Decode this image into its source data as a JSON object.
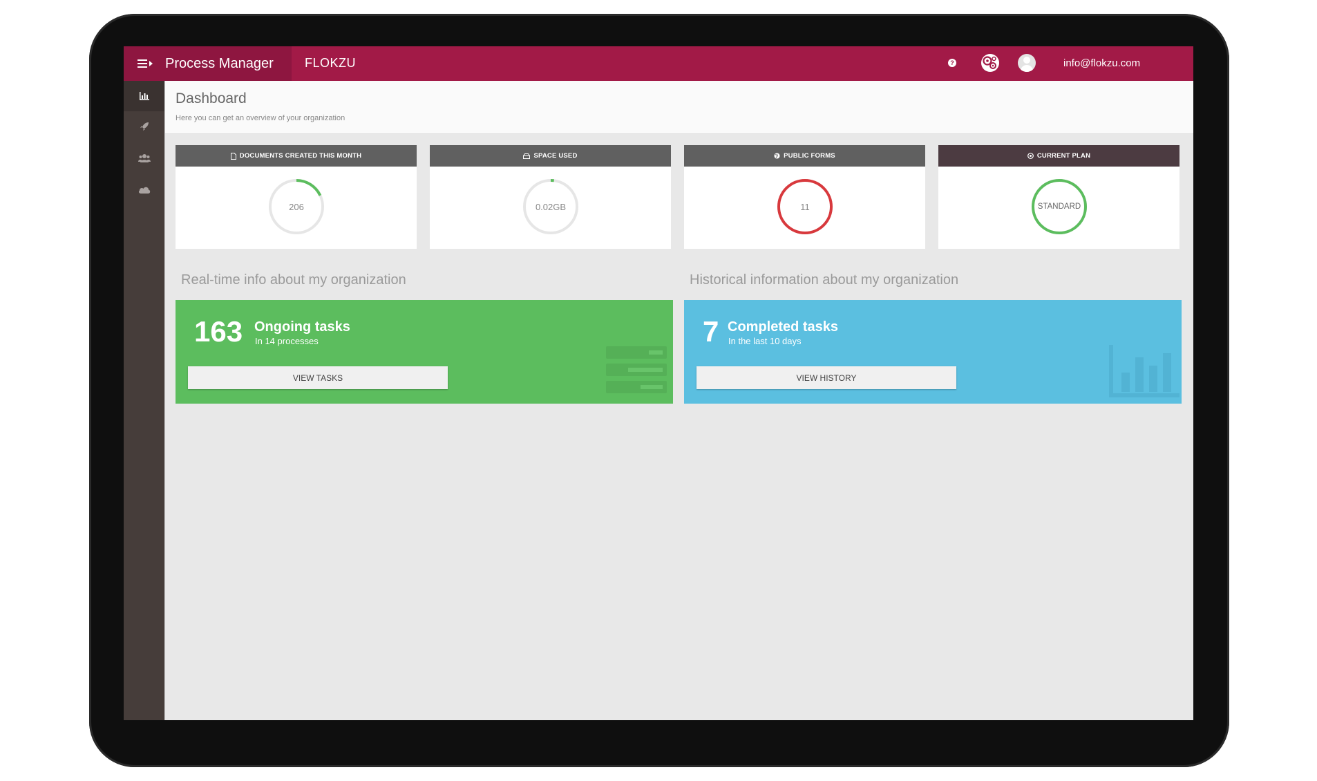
{
  "topbar": {
    "app_title": "Process Manager",
    "org_name": "FLOKZU",
    "help_glyph": "?",
    "user_email": "info@flokzu.com"
  },
  "sidebar": {
    "items": [
      {
        "icon": "bar-chart-icon",
        "active": true
      },
      {
        "icon": "rocket-icon",
        "active": false
      },
      {
        "icon": "users-icon",
        "active": false
      },
      {
        "icon": "cloud-icon",
        "active": false
      }
    ]
  },
  "header": {
    "title": "Dashboard",
    "subtitle": "Here you can get an overview of your organization"
  },
  "stats": [
    {
      "label": "DOCUMENTS CREATED THIS MONTH",
      "value": "206",
      "ring_color": "#5cbd5e",
      "progress": 0.18
    },
    {
      "label": "SPACE USED",
      "value": "0.02GB",
      "ring_color": "#5cbd5e",
      "progress": 0.02
    },
    {
      "label": "PUBLIC FORMS",
      "value": "11",
      "ring_color": "#d8393d",
      "progress": 1.0
    },
    {
      "label": "CURRENT PLAN",
      "value": "STANDARD",
      "ring_color": "#5cbd5e",
      "progress": 1.0
    }
  ],
  "sections": {
    "realtime_title": "Real-time info about my organization",
    "historical_title": "Historical information about my organization"
  },
  "ongoing": {
    "count": "163",
    "title": "Ongoing tasks",
    "subtitle": "In 14 processes",
    "button": "VIEW TASKS",
    "color": "#5cbd5e"
  },
  "completed": {
    "count": "7",
    "title": "Completed tasks",
    "subtitle": "In the last 10 days",
    "button": "VIEW HISTORY",
    "color": "#5bbfe0"
  },
  "colors": {
    "topbar": "#a21a47",
    "sidebar": "#463d3a",
    "ring_track": "#e6e6e6"
  }
}
